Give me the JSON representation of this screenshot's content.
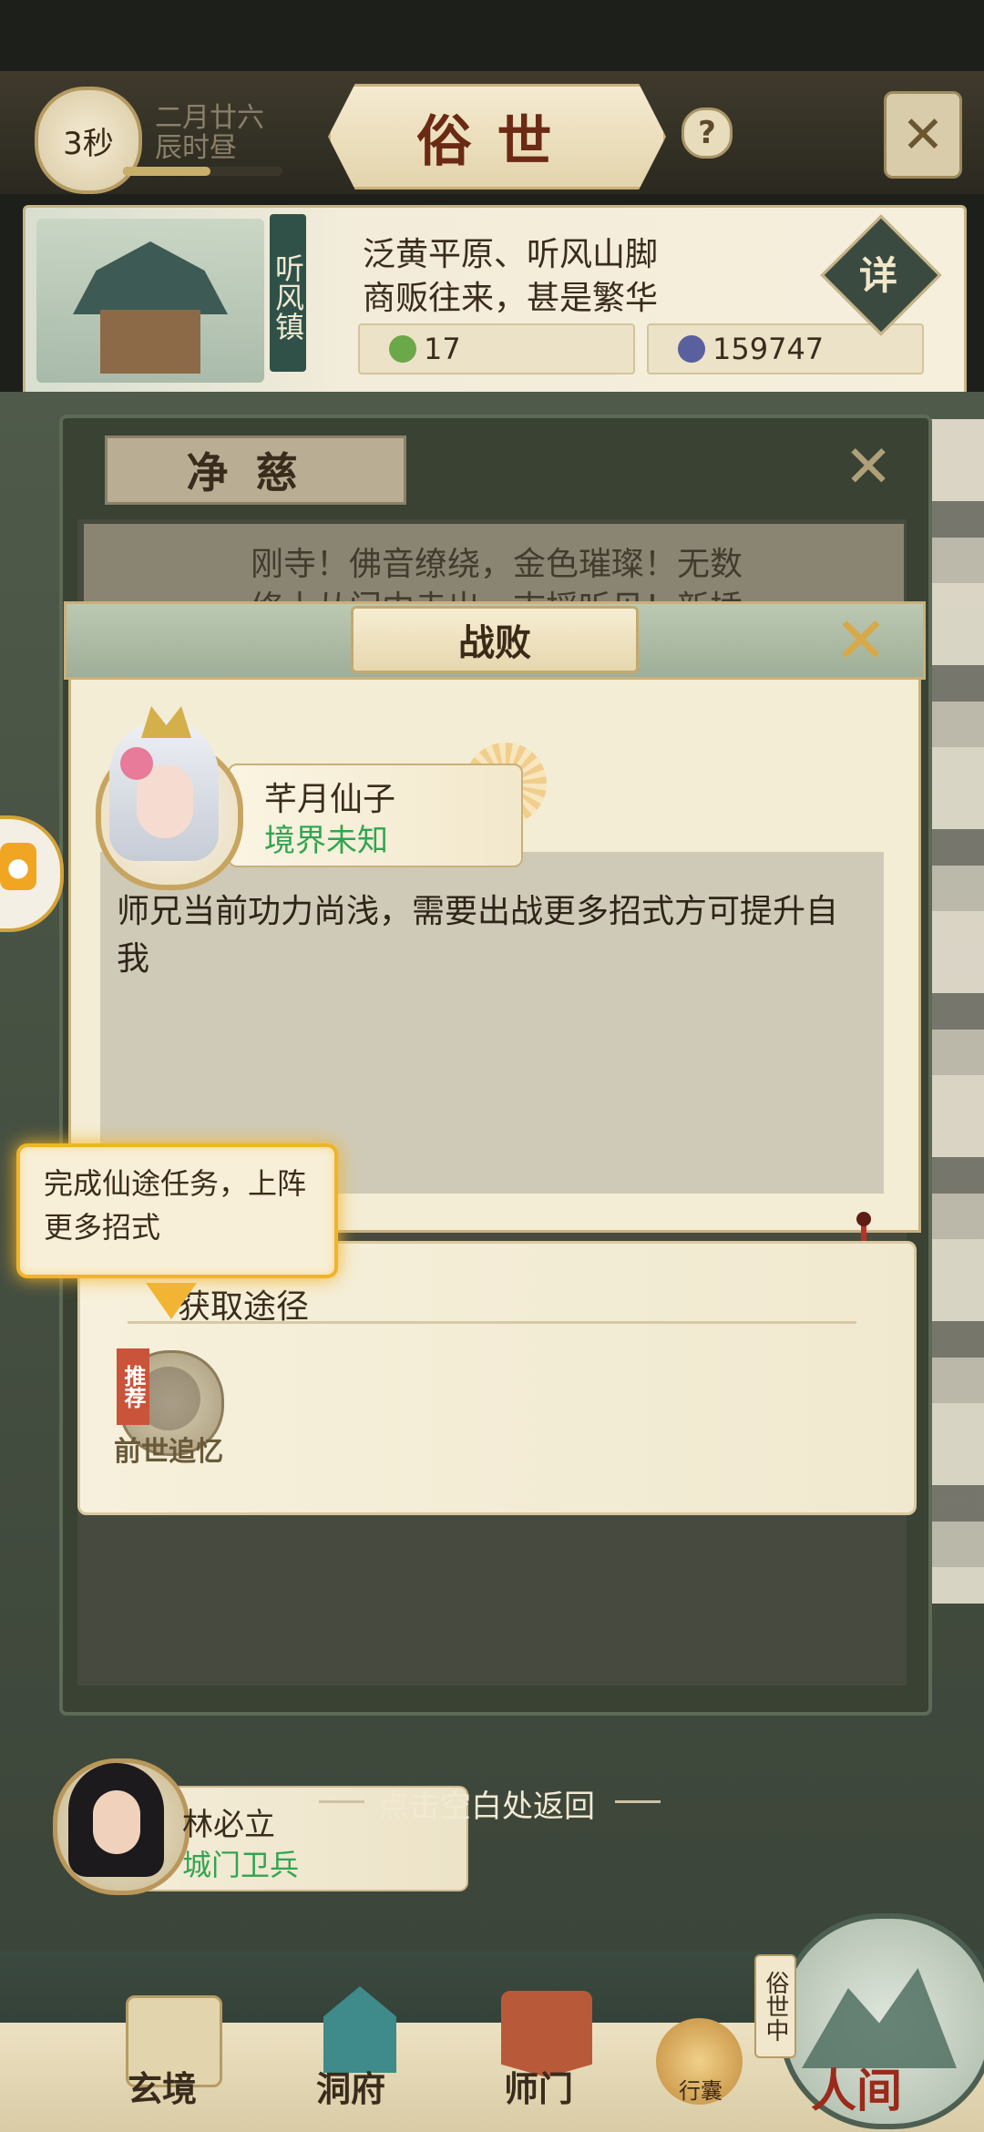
{
  "header": {
    "timer": "3秒",
    "date_line1": "二月廿六",
    "date_line2": "辰时昼",
    "title": "俗世",
    "time_progress": 0.55
  },
  "location": {
    "name": "听风镇",
    "desc_line1": "泛黄平原、听风山脚",
    "desc_line2": "商贩往来，甚是繁华",
    "resource1": "17",
    "resource2": "159747",
    "detail_label": "详"
  },
  "under_dialog": {
    "title": "净慈",
    "text_line1": "刚寺！佛音缭绕，金色璀璨！无数",
    "text_line2": "修士从门中走出，志摇听见！新插"
  },
  "defeat_dialog": {
    "title": "战败",
    "npc_name": "芊月仙子",
    "npc_realm": "境界未知",
    "message": "师兄当前功力尚浅，需要出战更多招式方可提升自我",
    "acquire_label": "获取途径",
    "recommend_badge": "推荐",
    "acquire_item": "前世追忆"
  },
  "tooltip": {
    "text": "完成仙途任务，上阵更多招式"
  },
  "bottom_npc": {
    "name": "林必立",
    "role": "城门卫兵"
  },
  "return_hint": "点击空白处返回",
  "nav": {
    "items": [
      "玄境",
      "洞府",
      "师门"
    ],
    "dish_label": "行囊",
    "in_world_label": "俗世中",
    "human_label": "人间"
  },
  "colors": {
    "realm_green": "#31a552",
    "tooltip_border": "#f0b42a",
    "title_red": "#6b2a14"
  }
}
